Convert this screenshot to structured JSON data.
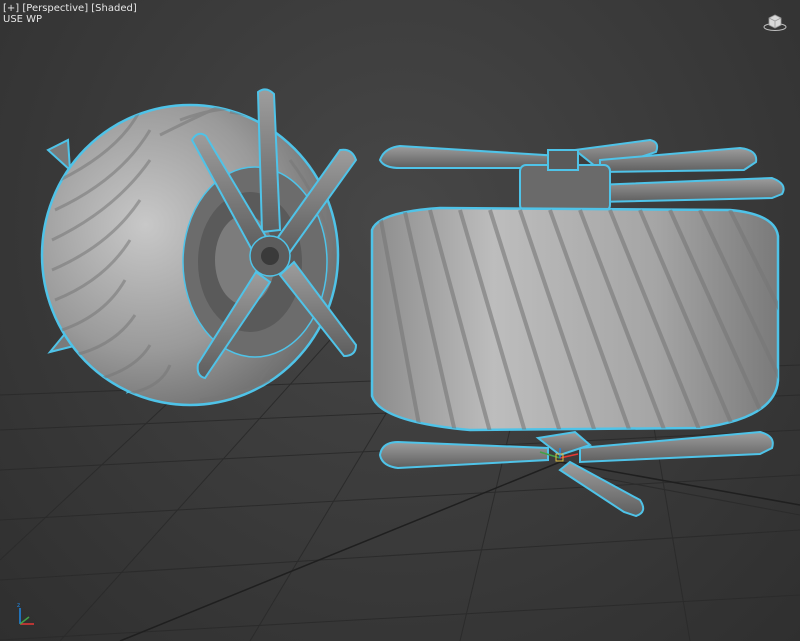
{
  "viewport": {
    "menu_plus": "[+]",
    "menu_view": "[Perspective]",
    "menu_shading": "[Shaded]",
    "sub_label": "USE WP"
  },
  "icons": {
    "viewcube": "viewcube-icon",
    "tripod": "world-axis-tripod-icon"
  },
  "colors": {
    "background": "#3c3c3c",
    "grid": "#2a2a2a",
    "selection_outline": "#4fc3e8",
    "model_gray": "#8a8a8a",
    "axis_x": "#e53935",
    "axis_y": "#43a047",
    "axis_z": "#1e88e5"
  }
}
